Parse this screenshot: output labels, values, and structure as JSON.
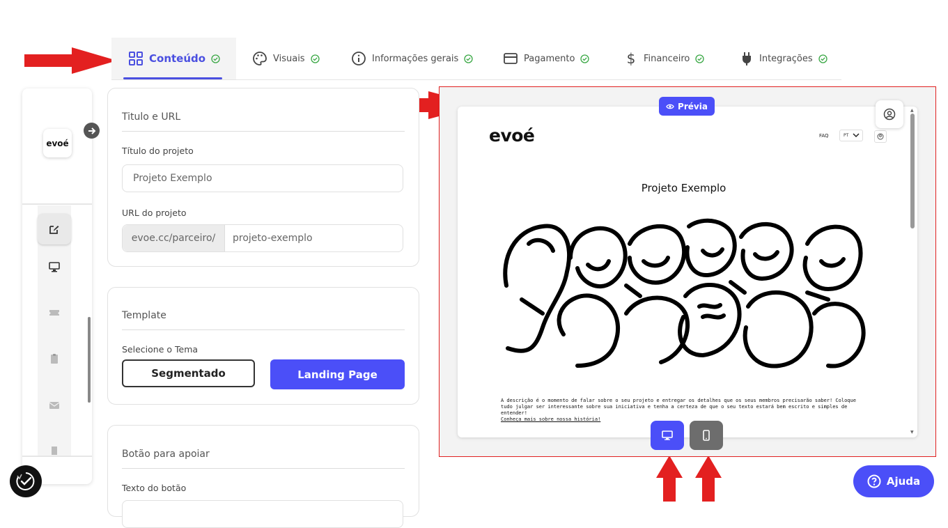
{
  "tabs": [
    {
      "label": "Conteúdo",
      "icon": "grid-icon",
      "status": "check"
    },
    {
      "label": "Visuais",
      "icon": "palette-icon",
      "status": "check"
    },
    {
      "label": "Informações gerais",
      "icon": "info-icon",
      "status": "check"
    },
    {
      "label": "Pagamento",
      "icon": "credit-card-icon",
      "status": "check"
    },
    {
      "label": "Financeiro",
      "icon": "dollar-icon",
      "status": "check"
    },
    {
      "label": "Integrações",
      "icon": "plug-icon",
      "status": "check"
    }
  ],
  "sidebar": {
    "logo_text": "evoé",
    "items": [
      {
        "icon": "edit-icon",
        "active": true
      },
      {
        "icon": "monitor-icon"
      },
      {
        "icon": "ticket-icon"
      },
      {
        "icon": "clipboard-icon"
      },
      {
        "icon": "mail-icon"
      },
      {
        "icon": "bookmark-icon"
      }
    ]
  },
  "title_card": {
    "heading": "Titulo e URL",
    "project_title_label": "Título do projeto",
    "project_title_value": "Projeto Exemplo",
    "url_label": "URL do projeto",
    "url_prefix": "evoe.cc/parceiro/",
    "url_value": "projeto-exemplo"
  },
  "template_card": {
    "heading": "Template",
    "theme_label": "Selecione o Tema",
    "option_segmented": "Segmentado",
    "option_landing": "Landing Page"
  },
  "support_card": {
    "heading": "Botão para apoiar",
    "button_text_label": "Texto do botão"
  },
  "preview": {
    "badge": "Prévia",
    "logo": "evoé",
    "faq": "FAQ",
    "lang": "PT",
    "title": "Projeto Exemplo",
    "description": "A descrição é o momento de falar sobre o seu projeto e entregar os detalhes que os seus membros precisarão saber! Coloque tudo julgar ser interessante sobre sua iniciativa e tenha a certeza de que o seu texto estará bem escrito e simples de entender!",
    "link": "Conheça mais sobre nossa história!"
  },
  "help_button": "Ajuda",
  "colors": {
    "accent": "#4b4ff8",
    "check": "#3aa845",
    "arrow": "#e32020"
  }
}
